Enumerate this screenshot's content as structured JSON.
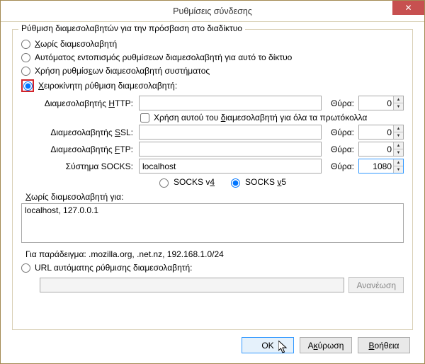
{
  "window": {
    "title": "Ρυθμίσεις σύνδεσης",
    "close_tooltip": "Close"
  },
  "group": {
    "legend": "Ρύθμιση διαμεσολαβητών για την πρόσβαση στο διαδίκτυο"
  },
  "radios": {
    "no_proxy": {
      "pre": "",
      "u": "Χ",
      "post": "ωρίς διαμεσολαβητή",
      "checked": false
    },
    "auto_detect": {
      "text": "Αυτόματος εντοπισμός ρυθμίσεων διαμεσολαβητή για αυτό το δίκτυο",
      "checked": false
    },
    "system": {
      "pre": "Χρήση ρυθμίσ",
      "u": "ε",
      "post": "ων διαμεσολαβητή συστήματος",
      "checked": false
    },
    "manual": {
      "pre": "",
      "u": "Χ",
      "post": "ειροκίνητη ρύθμιση διαμεσολαβητή:",
      "checked": true
    },
    "pac": {
      "text": "URL αυτόματης ρύθμισης διαμεσολαβητή:",
      "checked": false
    }
  },
  "proxy": {
    "port_label": "Θύρα:",
    "http": {
      "label_pre": "Διαμεσολαβητής ",
      "label_u": "H",
      "label_post": "TTP:",
      "host": "",
      "port": "0"
    },
    "share": {
      "pre": "Χρήση αυτού του ",
      "u": "δ",
      "post": "ιαμεσολαβητή για όλα τα πρωτόκολλα",
      "checked": false
    },
    "ssl": {
      "label_pre": "Διαμεσολαβητής ",
      "label_u": "S",
      "label_post": "SL:",
      "host": "",
      "port": "0"
    },
    "ftp": {
      "label_pre": "Διαμεσολαβητής ",
      "label_u": "F",
      "label_post": "TP:",
      "host": "",
      "port": "0"
    },
    "socks": {
      "label": "Σύστημα SOCKS:",
      "host": "localhost",
      "port": "1080"
    },
    "socks_v4": {
      "label_pre": "SOCKS v",
      "label_u": "4",
      "checked": false
    },
    "socks_v5": {
      "label_pre": "SOCKS ",
      "label_u": "v",
      "label_post": "5",
      "checked": true
    }
  },
  "noproxy": {
    "label_pre": "",
    "label_u": "Χ",
    "label_post": "ωρίς διαμεσολαβητή για:",
    "value": "localhost, 127.0.0.1",
    "example": "Για παράδειγμα: .mozilla.org, .net.nz, 192.168.1.0/24"
  },
  "pac": {
    "url": "",
    "reload": "Ανανέωση"
  },
  "buttons": {
    "ok": "OK",
    "cancel_pre": "Α",
    "cancel_u": "κ",
    "cancel_post": "ύρωση",
    "help_pre": "",
    "help_u": "Β",
    "help_post": "οήθεια"
  }
}
